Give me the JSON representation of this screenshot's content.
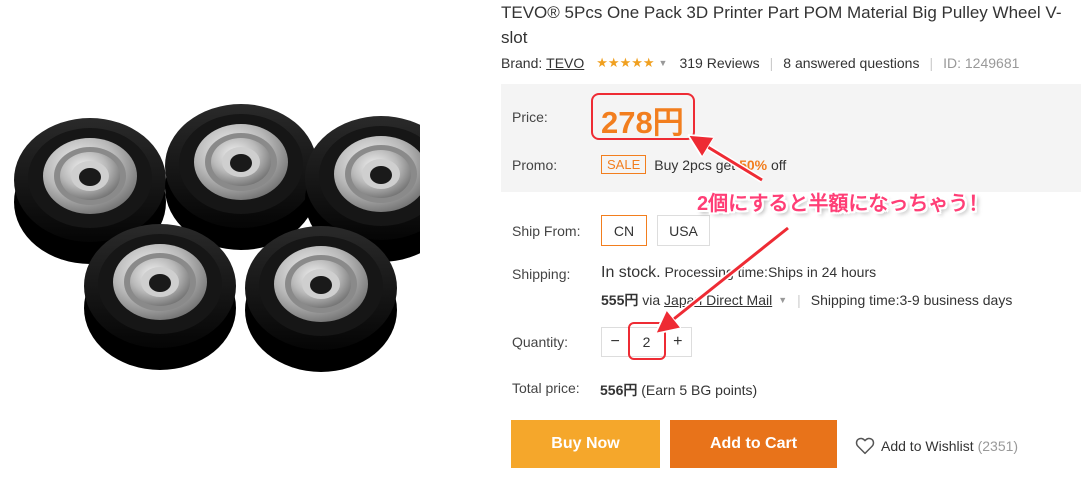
{
  "product": {
    "title": "TEVO® 5Pcs One Pack 3D Printer Part POM Material Big Pulley Wheel V-slot",
    "brand_label": "Brand:",
    "brand_name": "TEVO",
    "rating": "★★★★★",
    "reviews": "319 Reviews",
    "answered": "8 answered questions",
    "id": "ID: 1249681"
  },
  "price": {
    "label": "Price:",
    "value": "278円"
  },
  "promo": {
    "label": "Promo:",
    "badge": "SALE",
    "text_before": "Buy 2pcs get ",
    "text_highlight": "50%",
    "text_after": " off"
  },
  "ship_from": {
    "label": "Ship From:",
    "options": [
      "CN",
      "USA"
    ],
    "selected": "CN"
  },
  "shipping": {
    "label": "Shipping:",
    "stock": "In stock.",
    "processing": "Processing time:Ships in 24 hours",
    "cost": "555円",
    "via": "via",
    "method": "Japan Direct Mail",
    "shipping_time": "Shipping time:3-9 business days"
  },
  "quantity": {
    "label": "Quantity:",
    "minus": "−",
    "value": "2",
    "plus": "+"
  },
  "total": {
    "label": "Total price:",
    "value": "556円",
    "points": "(Earn 5 BG points)"
  },
  "actions": {
    "buy_now": "Buy Now",
    "add_to_cart": "Add to Cart",
    "wishlist": "Add to Wishlist",
    "wishlist_count": "(2351)"
  },
  "annotation": {
    "text": "2個にすると半額になっちゃう！",
    "color": "#ff3e76"
  },
  "colors": {
    "accent": "#f27e1e",
    "buy_now": "#f5a72b",
    "add_to_cart": "#e8731a",
    "highlight_red": "#ee2b34"
  }
}
